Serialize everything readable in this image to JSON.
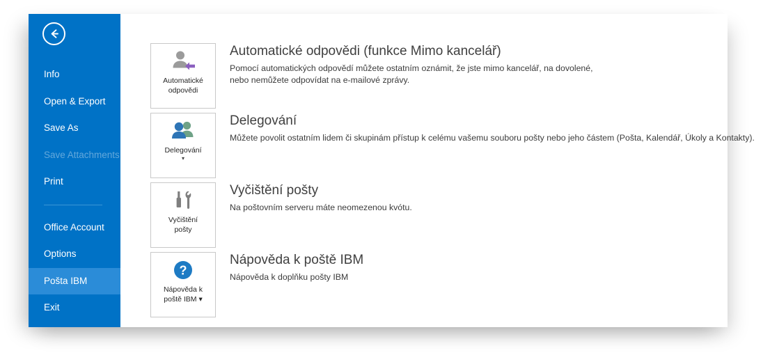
{
  "window": {
    "back_button": "back-arrow-icon"
  },
  "sidebar": {
    "accent_color": "#0072c6",
    "selected_color": "#2b8cd8",
    "items": [
      {
        "label": "Info",
        "state": "normal"
      },
      {
        "label": "Open & Export",
        "state": "normal"
      },
      {
        "label": "Save As",
        "state": "normal"
      },
      {
        "label": "Save Attachments",
        "state": "disabled"
      },
      {
        "label": "Print",
        "state": "normal"
      },
      {
        "label": "Office Account",
        "state": "normal"
      },
      {
        "label": "Options",
        "state": "normal"
      },
      {
        "label": "Pošta IBM",
        "state": "selected"
      },
      {
        "label": "Exit",
        "state": "normal"
      }
    ]
  },
  "main": {
    "cards": [
      {
        "tile_label_line1": "Automatické",
        "tile_label_line2": "odpovědi",
        "tile_caret": "",
        "icon": "person-reply-icon",
        "title": "Automatické odpovědi (funkce Mimo kancelář)",
        "desc_line1": "Pomocí automatických odpovědí můžete ostatním oznámit, že jste mimo kancelář, na dovolené,",
        "desc_line2": "nebo nemůžete odpovídat na e-mailové zprávy."
      },
      {
        "tile_label_line1": "Delegování",
        "tile_label_line2": "",
        "tile_caret": "▾",
        "icon": "two-people-icon",
        "title": "Delegování",
        "desc_line1": "Můžete povolit ostatním lidem či skupinám přístup k celému vašemu souboru pošty nebo jeho částem (Pošta, Kalendář, Úkoly a Kontakty).",
        "desc_line2": ""
      },
      {
        "tile_label_line1": "Vyčištění",
        "tile_label_line2": "pošty",
        "tile_caret": "",
        "icon": "tools-icon",
        "title": "Vyčištění pošty",
        "desc_line1": "Na poštovním serveru máte neomezenou kvótu.",
        "desc_line2": ""
      },
      {
        "tile_label_line1": "Nápověda k",
        "tile_label_line2": "poště IBM ▾",
        "tile_caret": "",
        "icon": "help-question-icon",
        "title": "Nápověda k poště IBM",
        "desc_line1": "Nápověda k doplňku pošty IBM",
        "desc_line2": ""
      }
    ]
  }
}
